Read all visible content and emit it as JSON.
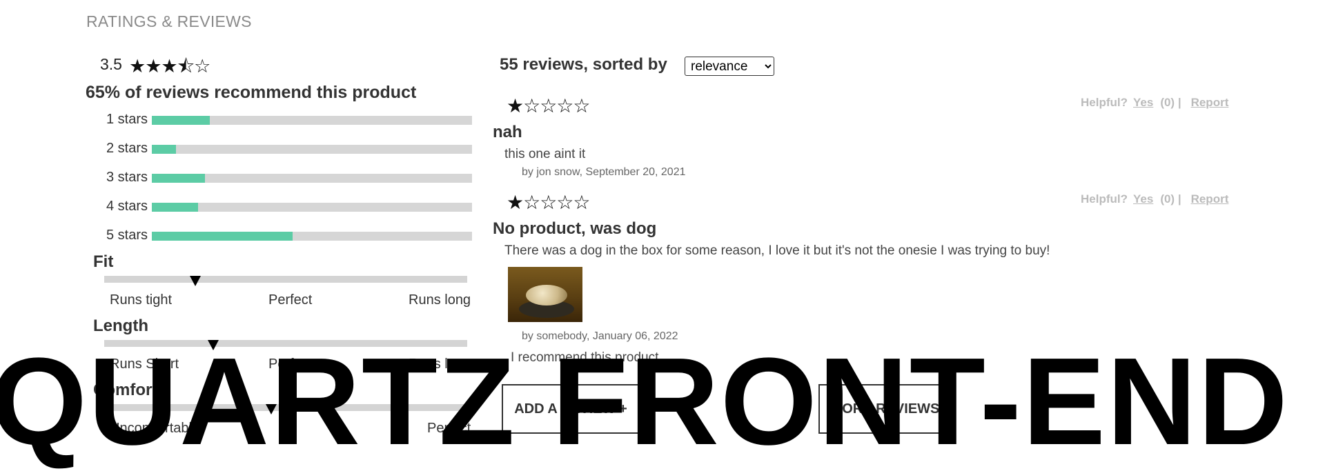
{
  "section_title": "RATINGS & REVIEWS",
  "summary": {
    "average": "3.5",
    "average_stars": "★★★⯪☆",
    "recommend_text": "65% of reviews recommend this product"
  },
  "breakdown": [
    {
      "label": "1 stars",
      "fraction": 0.18
    },
    {
      "label": "2 stars",
      "fraction": 0.075
    },
    {
      "label": "3 stars",
      "fraction": 0.165
    },
    {
      "label": "4 stars",
      "fraction": 0.145
    },
    {
      "label": "5 stars",
      "fraction": 0.44
    }
  ],
  "characteristics": [
    {
      "name": "Fit",
      "value": 0.25,
      "labels": [
        "Runs tight",
        "Perfect",
        "Runs long"
      ]
    },
    {
      "name": "Length",
      "value": 0.3,
      "labels": [
        "Runs Short",
        "Perfect",
        "Runs long"
      ]
    },
    {
      "name": "Comfort",
      "value": 0.46,
      "labels": [
        "Uncomfortable",
        "",
        "Perfect"
      ]
    }
  ],
  "reviews_list": {
    "header": "55 reviews, sorted by",
    "sort_value": "relevance",
    "sort_options": [
      "relevance"
    ],
    "items": [
      {
        "stars": "★☆☆☆☆",
        "title": "nah",
        "body": "this one aint it",
        "byline": "by jon snow, September 20, 2021",
        "helpful_label": "Helpful?",
        "yes_label": "Yes",
        "count": "(0) |",
        "report_label": "Report"
      },
      {
        "stars": "★☆☆☆☆",
        "title": "No product, was dog",
        "body": "There was a dog in the box for some reason, I love it but it's not the onesie I was trying to buy!",
        "byline": "by somebody, January 06, 2022",
        "recommend_line": "I recommend this product",
        "helpful_label": "Helpful?",
        "yes_label": "Yes",
        "count": "(0) |",
        "report_label": "Report"
      }
    ]
  },
  "buttons": {
    "add_review": "ADD A REVIEW +",
    "more_reviews": "MORE REVIEWS"
  },
  "watermark": "QUARTZ FRONT-END"
}
